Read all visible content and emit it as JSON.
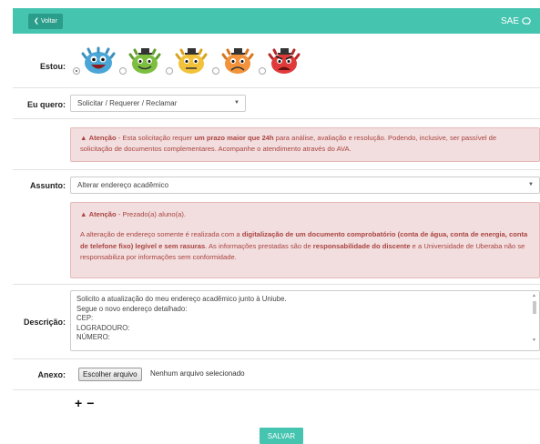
{
  "header": {
    "back_label": "Voltar",
    "title": "SAE",
    "chat_icon": "chat-bubble-icon"
  },
  "mood": {
    "label": "Estou:",
    "options": [
      "very-happy",
      "happy",
      "neutral",
      "sad",
      "angry"
    ],
    "selected_index": 0,
    "colors": [
      "#4aa6d6",
      "#7cbf3f",
      "#f2c23a",
      "#f2923a",
      "#e03b3b"
    ]
  },
  "request": {
    "label": "Eu quero:",
    "value": "Solicitar / Requerer / Reclamar"
  },
  "alert1": {
    "prefix": "Atenção",
    "t1": " - Esta solicitação requer ",
    "b1": "um prazo maior que 24h",
    "t2": " para análise, avaliação e resolução. Podendo, inclusive, ser passível de solicitação de documentos complementares. Acompanhe o atendimento através do AVA."
  },
  "subject": {
    "label": "Assunto:",
    "value": "Alterar endereço acadêmico"
  },
  "alert2": {
    "prefix": "Atenção",
    "greeting": " - Prezado(a) aluno(a).",
    "t1": "A alteração de endereço somente é realizada com a ",
    "b1": "digitalização de um documento comprobatório (conta de água, conta de energia, conta de telefone fixo) legível e sem rasuras",
    "t2": ". As informações prestadas são de ",
    "b2": "responsabilidade do discente",
    "t3": " e a Universidade de Uberaba não se responsabiliza por informações sem conformidade."
  },
  "description": {
    "label": "Descrição:",
    "lines": [
      "Solicito a atualização do meu endereço acadêmico junto à Uniube.",
      "Segue o novo endereço detalhado:",
      "CEP:",
      "LOGRADOURO:",
      "NÚMERO:"
    ]
  },
  "attachment": {
    "label": "Anexo:",
    "button": "Escolher arquivo",
    "status": "Nenhum arquivo selecionado"
  },
  "controls": {
    "plus": "+",
    "minus": "−"
  },
  "save_label": "SALVAR"
}
